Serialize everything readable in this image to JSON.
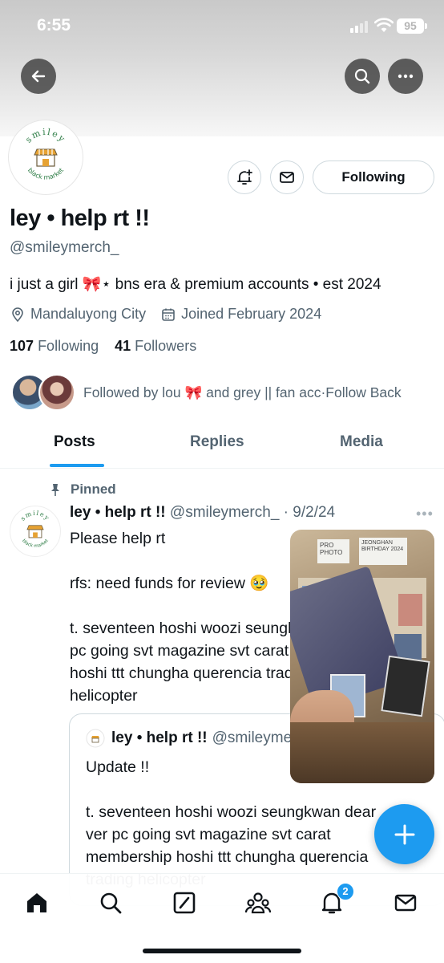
{
  "status": {
    "time": "6:55",
    "battery": "95"
  },
  "profile": {
    "display_name": "ley • help rt !!",
    "handle": "@smileymerch_",
    "bio": "i just a girl 🎀⋆ bns era & premium accounts • est 2024",
    "location": "Mandaluyong City",
    "joined": "Joined February 2024",
    "following_count": "107",
    "following_label": "Following",
    "followers_count": "41",
    "followers_label": "Followers",
    "followed_by": "Followed by lou 🎀 and grey || fan acc·Follow Back",
    "logo_text_top": "smiley",
    "logo_text_bottom": "black market"
  },
  "actions": {
    "following_button": "Following"
  },
  "tabs": [
    {
      "label": "Posts"
    },
    {
      "label": "Replies"
    },
    {
      "label": "Media"
    }
  ],
  "post": {
    "pinned_label": "Pinned",
    "author_name": "ley • help rt !!",
    "author_handle": "@smileymerch_",
    "date": "· 9/2/24",
    "line1": "Please help rt",
    "line2": "rfs: need funds for review 🥹",
    "line3": "t. seventeen hoshi woozi seungkwan dear\npc going svt magazine svt carat membership\nhoshi ttt chungha querencia trading\nhelicopter"
  },
  "quote": {
    "author_name": "ley • help rt !!",
    "author_handle": "@smileymerch_",
    "line1": "Update !!",
    "line2": "t. seventeen hoshi woozi seungkwan dear\nver pc going svt magazine svt carat\nmembership hoshi ttt chungha querencia\ntrading helicopter"
  },
  "video": {
    "card_label_1": "PRO PHOTO",
    "card_label_2": "JEONGHAN BIRTHDAY 2024"
  },
  "nav": {
    "notification_badge": "2"
  },
  "colors": {
    "accent": "#1d9bf0",
    "text": "#0f1419",
    "muted": "#536471"
  }
}
